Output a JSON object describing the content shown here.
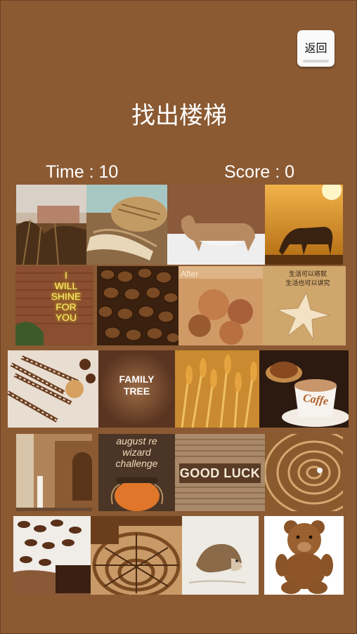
{
  "header": {
    "back_label": "返回",
    "title": "找出楼梯"
  },
  "stats": {
    "time_label": "Time : 10",
    "score_label": "Score : 0"
  },
  "tiles": {
    "after_label": "After",
    "neon_text": [
      "I",
      "WILL",
      "SHINE",
      "FOR",
      "YOU"
    ],
    "chinese_note": [
      "生活可以将就",
      "生活也可以讲究"
    ],
    "family_tree": [
      "FAMILY",
      "TREE"
    ],
    "cafe_text": "Caffe",
    "wizard_text": [
      "august re",
      "wizard",
      "challenge"
    ],
    "good_luck": "GOOD LUCK"
  }
}
